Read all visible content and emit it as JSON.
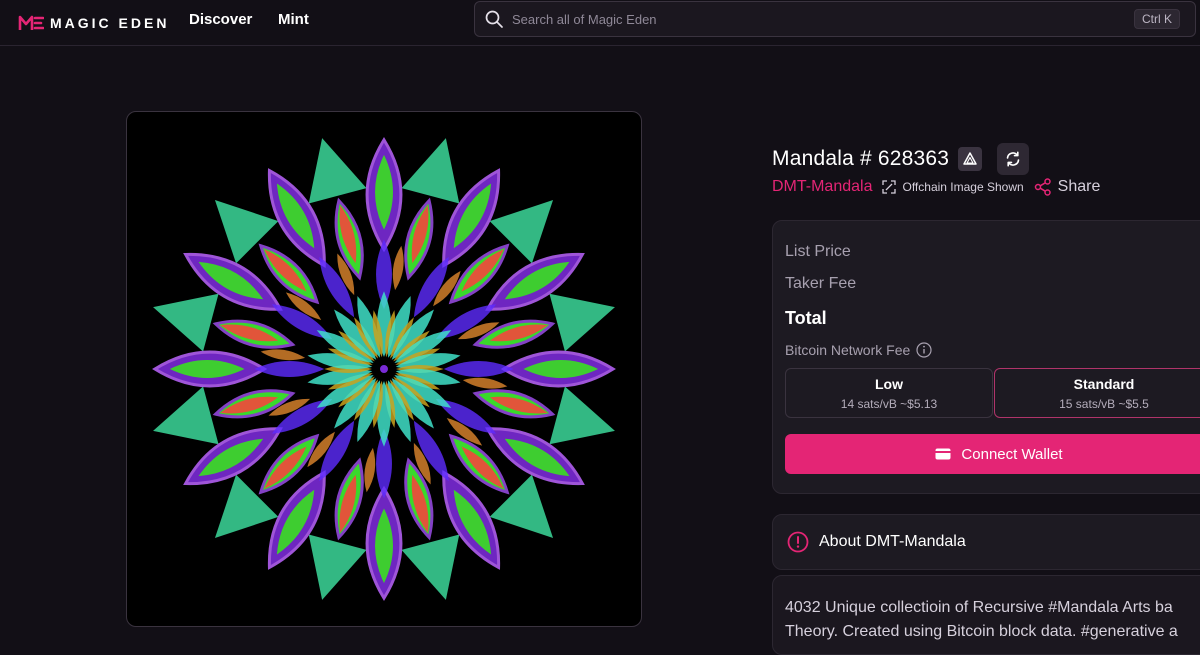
{
  "brand": {
    "name": "MAGIC EDEN",
    "accent_color": "#e42575"
  },
  "nav": {
    "discover": "Discover",
    "mint": "Mint"
  },
  "search": {
    "placeholder": "Search all of Magic Eden",
    "shortcut": "Ctrl K"
  },
  "item": {
    "title": "Mandala # 628363",
    "collection": "DMT-Mandala",
    "offchain_label": "Offchain Image Shown",
    "share_label": "Share",
    "icons": [
      "sigma-badge-icon",
      "refresh-icon",
      "expand-icon",
      "share-icon"
    ]
  },
  "pricing": {
    "list_price_label": "List Price",
    "taker_fee_label": "Taker Fee",
    "total_label": "Total",
    "network_fee_label": "Bitcoin Network Fee",
    "fee_options": [
      {
        "name": "Low",
        "detail": "14 sats/vB ~$5.13"
      },
      {
        "name": "Standard",
        "detail": "15 sats/vB ~$5.5"
      }
    ],
    "connect_label": "Connect Wallet"
  },
  "about": {
    "title": "About DMT-Mandala",
    "description_line1": "4032 Unique collectioin of Recursive #Mandala Arts ba",
    "description_line2": "Theory. Created using Bitcoin block data. #generative a"
  }
}
